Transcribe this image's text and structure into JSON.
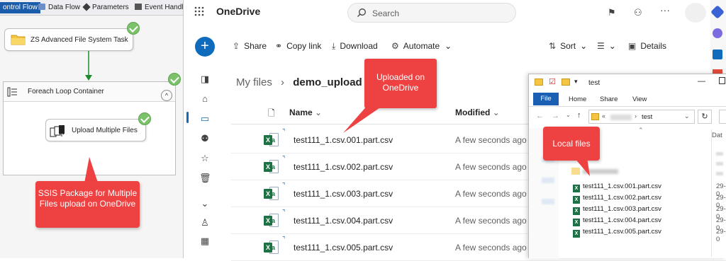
{
  "ssis": {
    "tabs": [
      {
        "label": "ontrol Flow",
        "active": true
      },
      {
        "label": "Data Flow",
        "active": false
      },
      {
        "label": "Parameters",
        "active": false
      },
      {
        "label": "Event Handle",
        "active": false
      }
    ],
    "task_file_system": "ZS Advanced File System Task",
    "container_title": "Foreach Loop Container",
    "task_upload": "Upload Multiple Files",
    "callout": "SSIS Package for Multiple Files upload on OneDrive"
  },
  "onedrive": {
    "app_title": "OneDrive",
    "search_placeholder": "Search",
    "toolbar": {
      "share": "Share",
      "copy_link": "Copy link",
      "download": "Download",
      "automate": "Automate",
      "sort": "Sort",
      "details": "Details"
    },
    "breadcrumb": {
      "root": "My files",
      "current": "demo_upload"
    },
    "columns": {
      "name": "Name",
      "modified": "Modified"
    },
    "files": [
      {
        "name": "test111_1.csv.001.part.csv",
        "modified": "A few seconds ago"
      },
      {
        "name": "test111_1.csv.002.part.csv",
        "modified": "A few seconds ago"
      },
      {
        "name": "test111_1.csv.003.part.csv",
        "modified": "A few seconds ago"
      },
      {
        "name": "test111_1.csv.004.part.csv",
        "modified": "A few seconds ago"
      },
      {
        "name": "test111_1.csv.005.part.csv",
        "modified": "A few seconds ago"
      }
    ],
    "callout": "Uploaded on OneDrive"
  },
  "explorer": {
    "title": "test",
    "ribbon_tabs": [
      "File",
      "Home",
      "Share",
      "View"
    ],
    "address_current": "test",
    "column_date": "Dat",
    "files": [
      {
        "name": "test111_1.csv.001.part.csv",
        "date": "29-0"
      },
      {
        "name": "test111_1.csv.002.part.csv",
        "date": "29-0"
      },
      {
        "name": "test111_1.csv.003.part.csv",
        "date": "29-0"
      },
      {
        "name": "test111_1.csv.004.part.csv",
        "date": "29-0"
      },
      {
        "name": "test111_1.csv.005.part.csv",
        "date": "29-0"
      }
    ],
    "callout": "Local files"
  },
  "colors": {
    "accent": "#0f6cbd",
    "callout_red": "#ee4242",
    "excel_green": "#1e7145",
    "ssis_tab_blue": "#1c5dab",
    "check_green": "#7cc26b"
  }
}
